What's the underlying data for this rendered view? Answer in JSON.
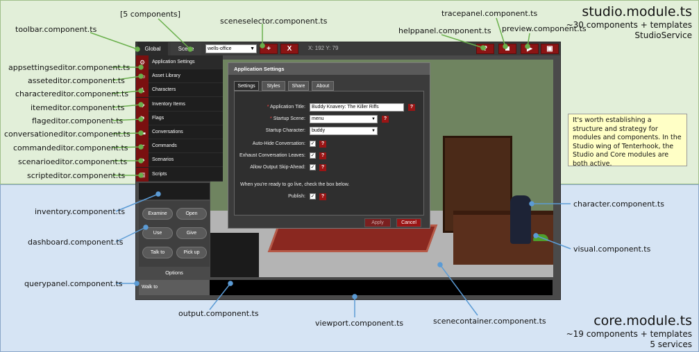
{
  "studio_module": {
    "title": "studio.module.ts",
    "note_lines": [
      "~30 components + templates",
      "StudioService"
    ]
  },
  "core_module": {
    "title": "core.module.ts",
    "note_lines": [
      "~19 components + templates",
      "5 services"
    ]
  },
  "note_box": "It's worth establishing a structure and strategy for modules and components. In the Studio wing of Tenterhook, the Studio and Core modules are both active.",
  "callouts": {
    "five_components": "[5 components]",
    "sceneselector": "sceneselector.component.ts",
    "tracepanel": "tracepanel.component.ts",
    "helppanel": "helppanel.component.ts",
    "preview": "preview.component.ts",
    "toolbar": "toolbar.component.ts",
    "appsettingseditor": "appsettingseditor.component.ts",
    "asseteditor": "asseteditor.component.ts",
    "charactereditor": "charactereditor.component.ts",
    "itemeditor": "itemeditor.component.ts",
    "flageditor": "flageditor.component.ts",
    "conversationeditor": "conversationeditor.component.ts",
    "commandeditor": "commandeditor.component.ts",
    "scenarioeditor": "scenarioeditor.component.ts",
    "scripteditor": "scripteditor.component.ts",
    "inventory": "inventory.component.ts",
    "dashboard": "dashboard.component.ts",
    "querypanel": "querypanel.component.ts",
    "output": "output.component.ts",
    "viewport": "viewport.component.ts",
    "scenecontainer": "scenecontainer.component.ts",
    "character": "character.component.ts",
    "visual": "visual.component.ts"
  },
  "toolbar": {
    "tab_global": "Global",
    "tab_scene": "Scene",
    "scene_value": "wells-office",
    "add_label": "+",
    "remove_label": "X",
    "coords": "X: 192 Y: 79",
    "help_label": "?"
  },
  "sidebar": {
    "items": [
      {
        "label": "Application Settings",
        "icon": "gear-icon",
        "glyph": "⚙"
      },
      {
        "label": "Asset Library",
        "icon": "folder-icon",
        "glyph": "▭"
      },
      {
        "label": "Characters",
        "icon": "person-icon",
        "glyph": "♟"
      },
      {
        "label": "Inventory Items",
        "icon": "cube-icon",
        "glyph": "◆"
      },
      {
        "label": "Flags",
        "icon": "flag-icon",
        "glyph": "⚑"
      },
      {
        "label": "Conversations",
        "icon": "speech-icon",
        "glyph": "▬"
      },
      {
        "label": "Commands",
        "icon": "pointer-icon",
        "glyph": "☛"
      },
      {
        "label": "Scenarios",
        "icon": "arrow-icon",
        "glyph": "➜"
      },
      {
        "label": "Scripts",
        "icon": "script-icon",
        "glyph": "▤"
      }
    ]
  },
  "dialog": {
    "title": "Application Settings",
    "tabs": [
      "Settings",
      "Styles",
      "Share",
      "About"
    ],
    "app_title_label": "Application Title:",
    "app_title_value": "Buddy Knavery: The Killer Riffs",
    "startup_scene_label": "Startup Scene:",
    "startup_scene_value": "menu",
    "startup_char_label": "Startup Character:",
    "startup_char_value": "buddy",
    "autohide_label": "Auto-Hide Conversation:",
    "exhaust_label": "Exhaust Conversation Leaves:",
    "skip_label": "Allow Output Skip-Ahead:",
    "ready_text": "When you're ready to go live, check the box below.",
    "publish_label": "Publish:",
    "apply_label": "Apply",
    "cancel_label": "Cancel",
    "required_mark": "*",
    "check_mark": "✓"
  },
  "dashboard": {
    "buttons": [
      "Examine",
      "Open",
      "Use",
      "Give",
      "Talk to",
      "Pick up"
    ],
    "options_label": "Options"
  },
  "querypanel": {
    "text": "Walk to"
  }
}
